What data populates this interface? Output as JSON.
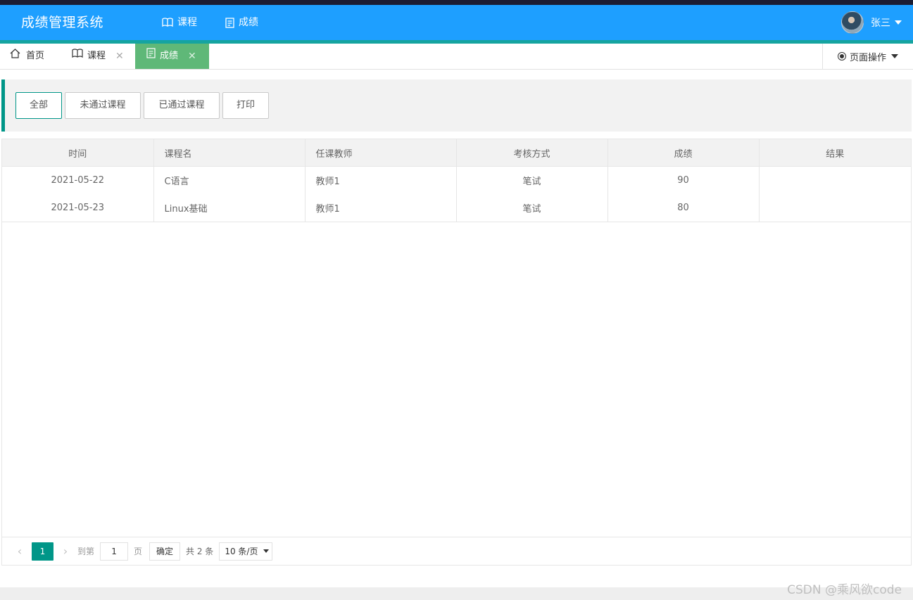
{
  "app": {
    "title": "成绩管理系统"
  },
  "nav": {
    "items": [
      {
        "label": "课程"
      },
      {
        "label": "成绩"
      }
    ]
  },
  "user": {
    "name": "张三"
  },
  "tabs": [
    {
      "label": "首页"
    },
    {
      "label": "课程"
    },
    {
      "label": "成绩"
    }
  ],
  "page_ops": {
    "label": "页面操作"
  },
  "filters": [
    {
      "label": "全部"
    },
    {
      "label": "未通过课程"
    },
    {
      "label": "已通过课程"
    },
    {
      "label": "打印"
    }
  ],
  "table": {
    "columns": [
      "时间",
      "课程名",
      "任课教师",
      "考核方式",
      "成绩",
      "结果"
    ],
    "rows": [
      {
        "time": "2021-05-22",
        "course": "C语言",
        "teacher": "教师1",
        "method": "笔试",
        "score": "90",
        "result": ""
      },
      {
        "time": "2021-05-23",
        "course": "Linux基础",
        "teacher": "教师1",
        "method": "笔试",
        "score": "80",
        "result": ""
      }
    ]
  },
  "pagination": {
    "prev": "‹",
    "current": "1",
    "next": "›",
    "goto_label": "到第",
    "goto_value": "1",
    "page_unit": "页",
    "confirm": "确定",
    "total": "共 2 条",
    "page_size": "10 条/页"
  },
  "watermark": "CSDN @乘风欲code",
  "colors": {
    "header": "#1e9fff",
    "accent": "#009688",
    "tab_active": "#5fb878"
  }
}
